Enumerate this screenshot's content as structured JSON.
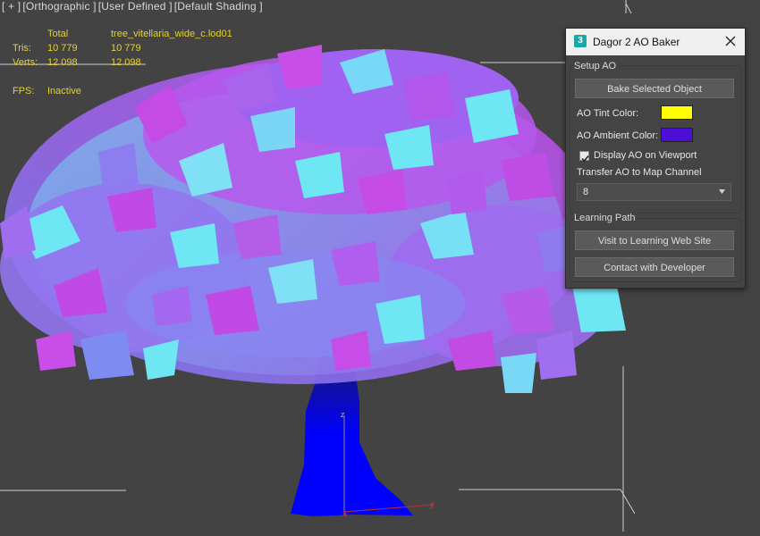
{
  "viewport": {
    "labels": [
      "[ + ]",
      "[Orthographic ]",
      "[User Defined ]",
      "[Default Shading ]"
    ]
  },
  "stats": {
    "col_total": "Total",
    "col_object": "tree_vitellaria_wide_c.lod01",
    "tris_label": "Tris:",
    "tris_total": "10 779",
    "tris_object": "10 779",
    "verts_label": "Verts:",
    "verts_total": "12 098",
    "verts_object": "12 098",
    "fps_label": "FPS:",
    "fps_value": "Inactive"
  },
  "dialog": {
    "app_icon": "3",
    "title": "Dagor 2 AO Baker",
    "close_icon": "close-icon",
    "setup_group": "Setup AO",
    "bake_button": "Bake Selected Object",
    "ao_tint_label": "AO Tint Color:",
    "ao_tint_color": "#FFFF00",
    "ao_ambient_label": "AO Ambient Color:",
    "ao_ambient_color": "#4B0FD6",
    "display_ao_label": "Display AO on Viewport",
    "display_ao_checked": true,
    "transfer_label": "Transfer AO to Map Channel",
    "map_channel": "8",
    "learning_group": "Learning Path",
    "visit_button": "Visit to Learning Web Site",
    "contact_button": "Contact with Developer"
  },
  "gizmo": {
    "x": "x",
    "y": "y",
    "z": "z"
  },
  "colors": {
    "viewport_bg": "#434343",
    "stats_text": "#E5D233",
    "dialog_bg": "#444444",
    "titlebar_bg": "#F0F0F0",
    "foliage_light": "#6FE6F4",
    "foliage_mid": "#A26BF0",
    "foliage_dark": "#C347E6",
    "trunk": "#0000FF"
  }
}
